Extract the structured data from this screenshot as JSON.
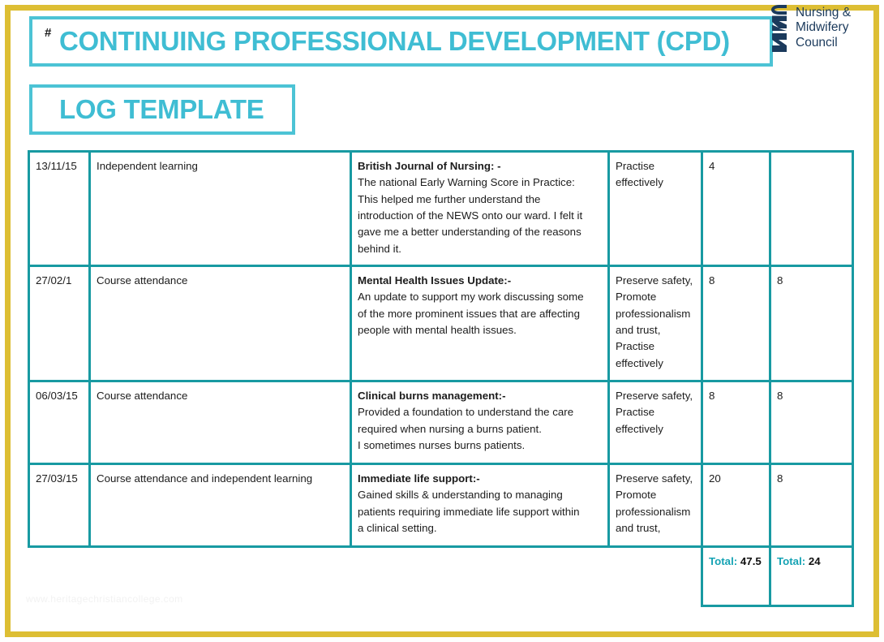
{
  "document": {
    "hash_mark": "#",
    "title_line_1": "CONTINUING PROFESSIONAL DEVELOPMENT (CPD)",
    "title_line_2": "LOG TEMPLATE",
    "watermark": "www.heritagechristiancollege.com",
    "colors": {
      "page_frame": "#ddbe33",
      "title_accent": "#3fbdd3",
      "table_border": "#189aa2",
      "logo_navy": "#1b3a5c",
      "total_label": "#16a3b4"
    }
  },
  "logo": {
    "mark": "nmc-monogram",
    "mark_text": "NMC",
    "line_1": "Nursing &",
    "line_2": "Midwifery",
    "line_3": "Council"
  },
  "table": {
    "rows": [
      {
        "date": "13/11/15",
        "type": "Independent learning",
        "description_title": "British Journal of Nursing: -",
        "description_lines": [
          "The national Early Warning Score in Practice:",
          "This helped me further understand the",
          "introduction of the NEWS onto our ward. I felt it",
          "gave me a better understanding of the reasons",
          "behind it."
        ],
        "code": "Practise effectively",
        "hours": "4",
        "participatory": ""
      },
      {
        "date": "27/02/1",
        "type": "Course attendance",
        "description_title": "Mental Health Issues Update:-",
        "description_lines": [
          "An update to support my work discussing some",
          "of the more prominent issues that are affecting",
          "people with mental health issues."
        ],
        "code": "Preserve safety, Promote professionalism and trust, Practise effectively",
        "hours": "8",
        "participatory": "8"
      },
      {
        "date": "06/03/15",
        "type": "Course attendance",
        "description_title": "Clinical burns management:-",
        "description_lines": [
          "Provided a foundation to understand the care",
          "required when nursing a burns patient.",
          "I sometimes nurses burns patients."
        ],
        "code": "Preserve safety, Practise effectively",
        "hours": "8",
        "participatory": "8"
      },
      {
        "date": "27/03/15",
        "type": "Course attendance and independent learning",
        "description_title": "Immediate life support:-",
        "description_lines": [
          "Gained skills & understanding to managing",
          "patients requiring immediate life support within",
          "a clinical setting."
        ],
        "code": "Preserve safety, Promote professionalism and trust,",
        "hours": "20",
        "participatory": "8"
      }
    ],
    "totals": {
      "hours_label": "Total:",
      "hours_value": "47.5",
      "participatory_label": "Total:",
      "participatory_value": "24"
    }
  }
}
